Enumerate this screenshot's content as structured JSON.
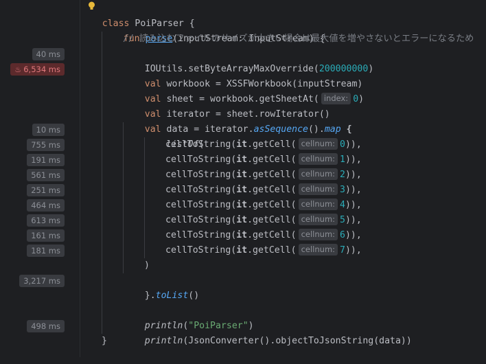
{
  "gutter": {
    "timings": [
      {
        "text": "40 ms",
        "hot": false,
        "line": 3
      },
      {
        "text": "6,534 ms",
        "hot": true,
        "line": 4
      },
      {
        "text": "10 ms",
        "hot": false,
        "line": 8
      },
      {
        "text": "755 ms",
        "hot": false,
        "line": 9
      },
      {
        "text": "191 ms",
        "hot": false,
        "line": 10
      },
      {
        "text": "561 ms",
        "hot": false,
        "line": 11
      },
      {
        "text": "251 ms",
        "hot": false,
        "line": 12
      },
      {
        "text": "464 ms",
        "hot": false,
        "line": 13
      },
      {
        "text": "613 ms",
        "hot": false,
        "line": 14
      },
      {
        "text": "161 ms",
        "hot": false,
        "line": 15
      },
      {
        "text": "181 ms",
        "hot": false,
        "line": 16
      },
      {
        "text": "3,217 ms",
        "hot": false,
        "line": 18
      },
      {
        "text": "498 ms",
        "hot": false,
        "line": 21
      }
    ]
  },
  "code": {
    "class_kw": "class",
    "class_name": " PoiParser {",
    "fun_kw": "fun",
    "fun_name": "parse",
    "fun_sig": "(inputStream: InputStream) {",
    "comment": "// 読み込むファイルのサイズが大きい場合は最大値を増やさないとエラーになるため",
    "l3_a": "IOUtils.setByteArrayMaxOverride(",
    "l3_num": "200000000",
    "l3_b": ")",
    "val_kw": "val",
    "l4": " workbook = XSSFWorkbook(inputStream)",
    "l5_a": " sheet = workbook.getSheetAt(",
    "l5_hint": "index:",
    "l5_num": "0",
    "l5_b": ")",
    "l6": " iterator = sheet.rowIterator()",
    "l7_a": " data = iterator.",
    "l7_seq": "asSequence",
    "l7_b": "().",
    "l7_map": "map",
    "l7_c": " {",
    "l8": "listOf",
    "l8_b": "(",
    "cell_fn": "cellToString(",
    "cell_it": "it",
    "cell_mid": ".getCell(",
    "cell_hint": "cellnum:",
    "cell_end": ")),",
    "cells": [
      "0",
      "1",
      "2",
      "3",
      "4",
      "5",
      "6",
      "7"
    ],
    "l17": ")",
    "l18_a": "}.",
    "l18_fn": "toList",
    "l18_b": "()",
    "println": "println",
    "l20_a": "(",
    "l20_str": "\"PoiParser\"",
    "l20_b": ")",
    "l21_rest": "(JsonConverter().objectToJsonString(data))",
    "l22": "}"
  }
}
